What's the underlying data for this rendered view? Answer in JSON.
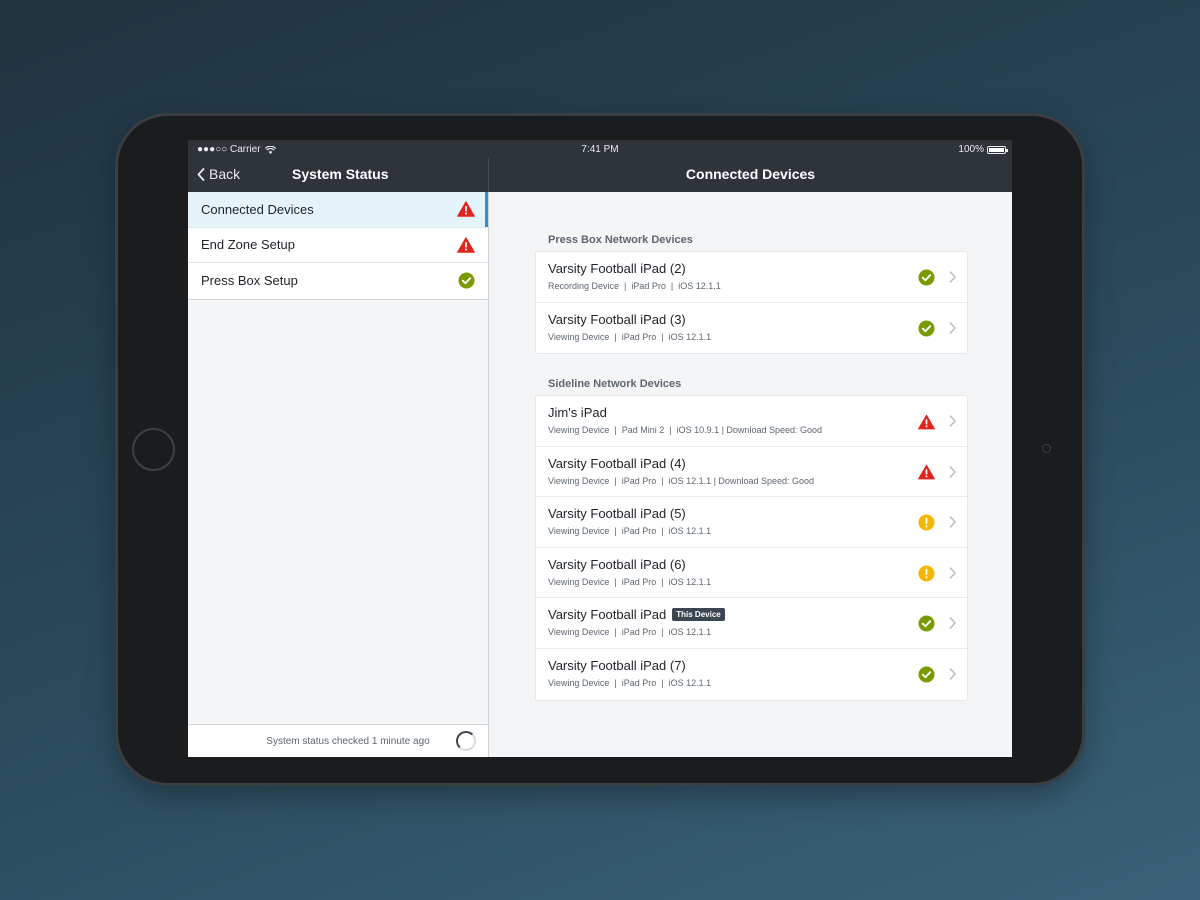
{
  "status_bar": {
    "carrier": "●●●○○ Carrier",
    "time": "7:41 PM",
    "battery": "100%"
  },
  "nav": {
    "back_label": "Back",
    "left_title": "System Status",
    "right_title": "Connected Devices"
  },
  "sidebar": {
    "items": [
      {
        "label": "Connected Devices",
        "status": "error",
        "active": true
      },
      {
        "label": "End Zone Setup",
        "status": "error",
        "active": false
      },
      {
        "label": "Press Box Setup",
        "status": "ok",
        "active": false
      }
    ],
    "footer_text": "System status checked 1 minute ago"
  },
  "sections": [
    {
      "title": "Press Box Network Devices",
      "devices": [
        {
          "name": "Varsity Football iPad (2)",
          "details": "Recording Device  |  iPad Pro  |  iOS 12.1.1",
          "status": "ok"
        },
        {
          "name": "Varsity Football iPad (3)",
          "details": "Viewing Device  |  iPad Pro  |  iOS 12.1.1",
          "status": "ok"
        }
      ]
    },
    {
      "title": "Sideline Network Devices",
      "devices": [
        {
          "name": "Jim's iPad",
          "details": "Viewing Device  |  Pad Mini 2  |  iOS 10.9.1 | Download Speed: Good",
          "status": "error"
        },
        {
          "name": "Varsity Football iPad (4)",
          "details": "Viewing Device  |  iPad Pro  |  iOS 12.1.1 | Download Speed: Good",
          "status": "error"
        },
        {
          "name": "Varsity Football iPad (5)",
          "details": "Viewing Device  |  iPad Pro  |  iOS 12.1.1",
          "status": "warning"
        },
        {
          "name": "Varsity Football iPad (6)",
          "details": "Viewing Device  |  iPad Pro  |  iOS 12.1.1",
          "status": "warning"
        },
        {
          "name": "Varsity Football iPad",
          "badge": "This Device",
          "details": "Viewing Device  |  iPad Pro  |  iOS 12.1.1",
          "status": "ok"
        },
        {
          "name": "Varsity Football iPad (7)",
          "details": "Viewing Device  |  iPad Pro  |  iOS 12.1.1",
          "status": "ok"
        }
      ]
    }
  ],
  "colors": {
    "ok": "#7a9a01",
    "error": "#e0251c",
    "warning": "#f2b705",
    "accent": "#1e9ad6",
    "nav_bg": "#2f343b"
  }
}
